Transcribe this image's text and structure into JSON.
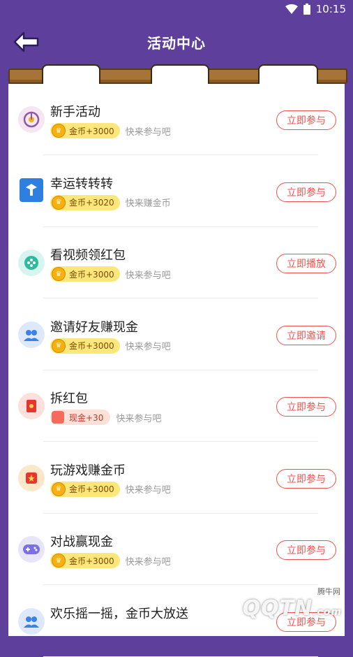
{
  "status_bar": {
    "time": "10:15"
  },
  "header": {
    "title": "活动中心"
  },
  "activities": [
    {
      "name": "新手活动",
      "reward": "金币+3000",
      "reward_type": "coin",
      "subtitle": "快来参与吧",
      "button": "立即参与",
      "icon": "target-icon",
      "icon_bg": "#f6e6f4",
      "icon_color": "#8b5aa8"
    },
    {
      "name": "幸运转转转",
      "reward": "金币+3020",
      "reward_type": "coin",
      "subtitle": "快来赚金币",
      "button": "立即参与",
      "icon": "lucky-wheel-icon",
      "icon_bg": "#2f7fe0",
      "icon_color": "#ffffff"
    },
    {
      "name": "看视频领红包",
      "reward": "金币+3000",
      "reward_type": "coin",
      "subtitle": "快来参与吧",
      "button": "立即播放",
      "icon": "video-play-icon",
      "icon_bg": "#d8f4ee",
      "icon_color": "#2dbba0"
    },
    {
      "name": "邀请好友赚现金",
      "reward": "金币+3000",
      "reward_type": "coin",
      "subtitle": "快来参与吧",
      "button": "立即邀请",
      "icon": "friends-icon",
      "icon_bg": "#dde9fb",
      "icon_color": "#3b82e6"
    },
    {
      "name": "拆红包",
      "reward": "现金+30",
      "reward_type": "cash",
      "subtitle": "快来参与吧",
      "button": "立即参与",
      "icon": "red-envelope-icon",
      "icon_bg": "#fde0dc",
      "icon_color": "#e8342e"
    },
    {
      "name": "玩游戏赚金币",
      "reward": "金币+3000",
      "reward_type": "coin",
      "subtitle": "快来参与吧",
      "button": "立即参与",
      "icon": "game-box-icon",
      "icon_bg": "#fde7c9",
      "icon_color": "#e8342e"
    },
    {
      "name": "对战赢现金",
      "reward": "金币+3000",
      "reward_type": "coin",
      "subtitle": "快来参与吧",
      "button": "立即参与",
      "icon": "gamepad-icon",
      "icon_bg": "#e8e5fb",
      "icon_color": "#7a6fe6"
    },
    {
      "name": "欢乐摇一摇，金币大放送",
      "reward": "",
      "reward_type": "coin",
      "subtitle": "",
      "button": "立即参与",
      "icon": "friends-icon",
      "icon_bg": "#dde9fb",
      "icon_color": "#3b82e6"
    }
  ],
  "watermark": {
    "brand": "QQTN",
    "cn": "腾牛网",
    "domain": ".com"
  },
  "colors": {
    "purple": "#5e3f9c",
    "button_red": "#f0524f",
    "coin_yellow": "#fde77a"
  }
}
